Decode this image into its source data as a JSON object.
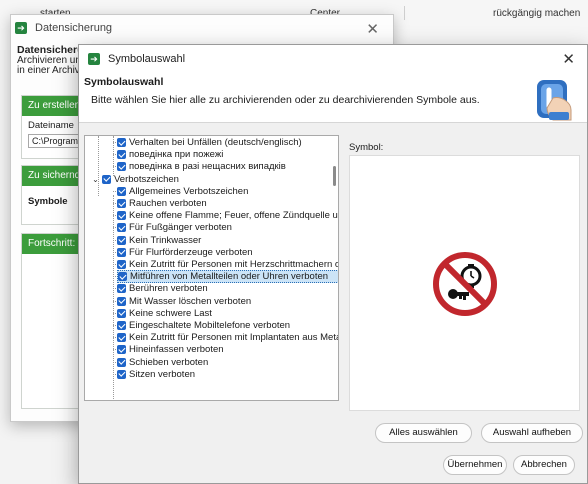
{
  "background": {
    "left_text": "starten",
    "mid_text": "Center",
    "right_text": "rückgängig machen"
  },
  "back_window": {
    "title": "Datensicherung",
    "heading": "Datensicherun",
    "desc_line1": "Archivieren und",
    "desc_line2": "in einer Archivda",
    "group1_header": "Zu erstellend",
    "file_label": "Dateiname",
    "file_value": "C:\\Program",
    "group2_header": "Zu sichernde",
    "symbol_label": "Symbole",
    "group3_header": "Fortschritt:"
  },
  "dialog": {
    "title": "Symbolauswahl",
    "header_title": "Symbolauswahl",
    "header_subtitle": "Bitte wählen Sie hier alle zu archivierenden oder zu dearchivierenden Symbole aus.",
    "symbol_label": "Symbol:",
    "tree": [
      {
        "label": "Verhalten bei Unfällen (deutsch/englisch)",
        "level": 1
      },
      {
        "label": "поведінка при пожежі",
        "level": 1
      },
      {
        "label": "поведінка в разі нещасних випадків",
        "level": 1
      },
      {
        "label": "Verbotszeichen",
        "level": 0,
        "expanded": true
      },
      {
        "label": "Allgemeines Verbotszeichen",
        "level": 1
      },
      {
        "label": "Rauchen verboten",
        "level": 1
      },
      {
        "label": "Keine offene Flamme; Feuer, offene Zündquelle und",
        "level": 1
      },
      {
        "label": "Für Fußgänger verboten",
        "level": 1
      },
      {
        "label": "Kein Trinkwasser",
        "level": 1
      },
      {
        "label": "Für Flurförderzeuge verboten",
        "level": 1
      },
      {
        "label": "Kein Zutritt für Personen mit Herzschrittmachern o",
        "level": 1
      },
      {
        "label": "Mitführen von Metallteilen oder Uhren verboten",
        "level": 1,
        "selected": true
      },
      {
        "label": "Berühren verboten",
        "level": 1
      },
      {
        "label": "Mit Wasser löschen verboten",
        "level": 1
      },
      {
        "label": "Keine schwere Last",
        "level": 1
      },
      {
        "label": "Eingeschaltete Mobiltelefone verboten",
        "level": 1
      },
      {
        "label": "Kein Zutritt für Personen mit Implantaten aus Meta",
        "level": 1
      },
      {
        "label": "Hineinfassen verboten",
        "level": 1
      },
      {
        "label": "Schieben verboten",
        "level": 1
      },
      {
        "label": "Sitzen verboten",
        "level": 1
      }
    ],
    "buttons": {
      "select_all": "Alles auswählen",
      "clear_selection": "Auswahl aufheben",
      "ok": "Übernehmen",
      "cancel": "Abbrechen"
    }
  },
  "colors": {
    "accent_green": "#25843f",
    "group_green": "#3c9d3c",
    "checkbox_blue": "#1e64c8",
    "selection_blue": "#cce4f7",
    "prohibition_red": "#c1272d"
  },
  "icons": [
    "app-icon",
    "close-icon",
    "symbol-selection-icon",
    "checkbox-icon",
    "expander-icon",
    "prohibition-sign-icon"
  ]
}
